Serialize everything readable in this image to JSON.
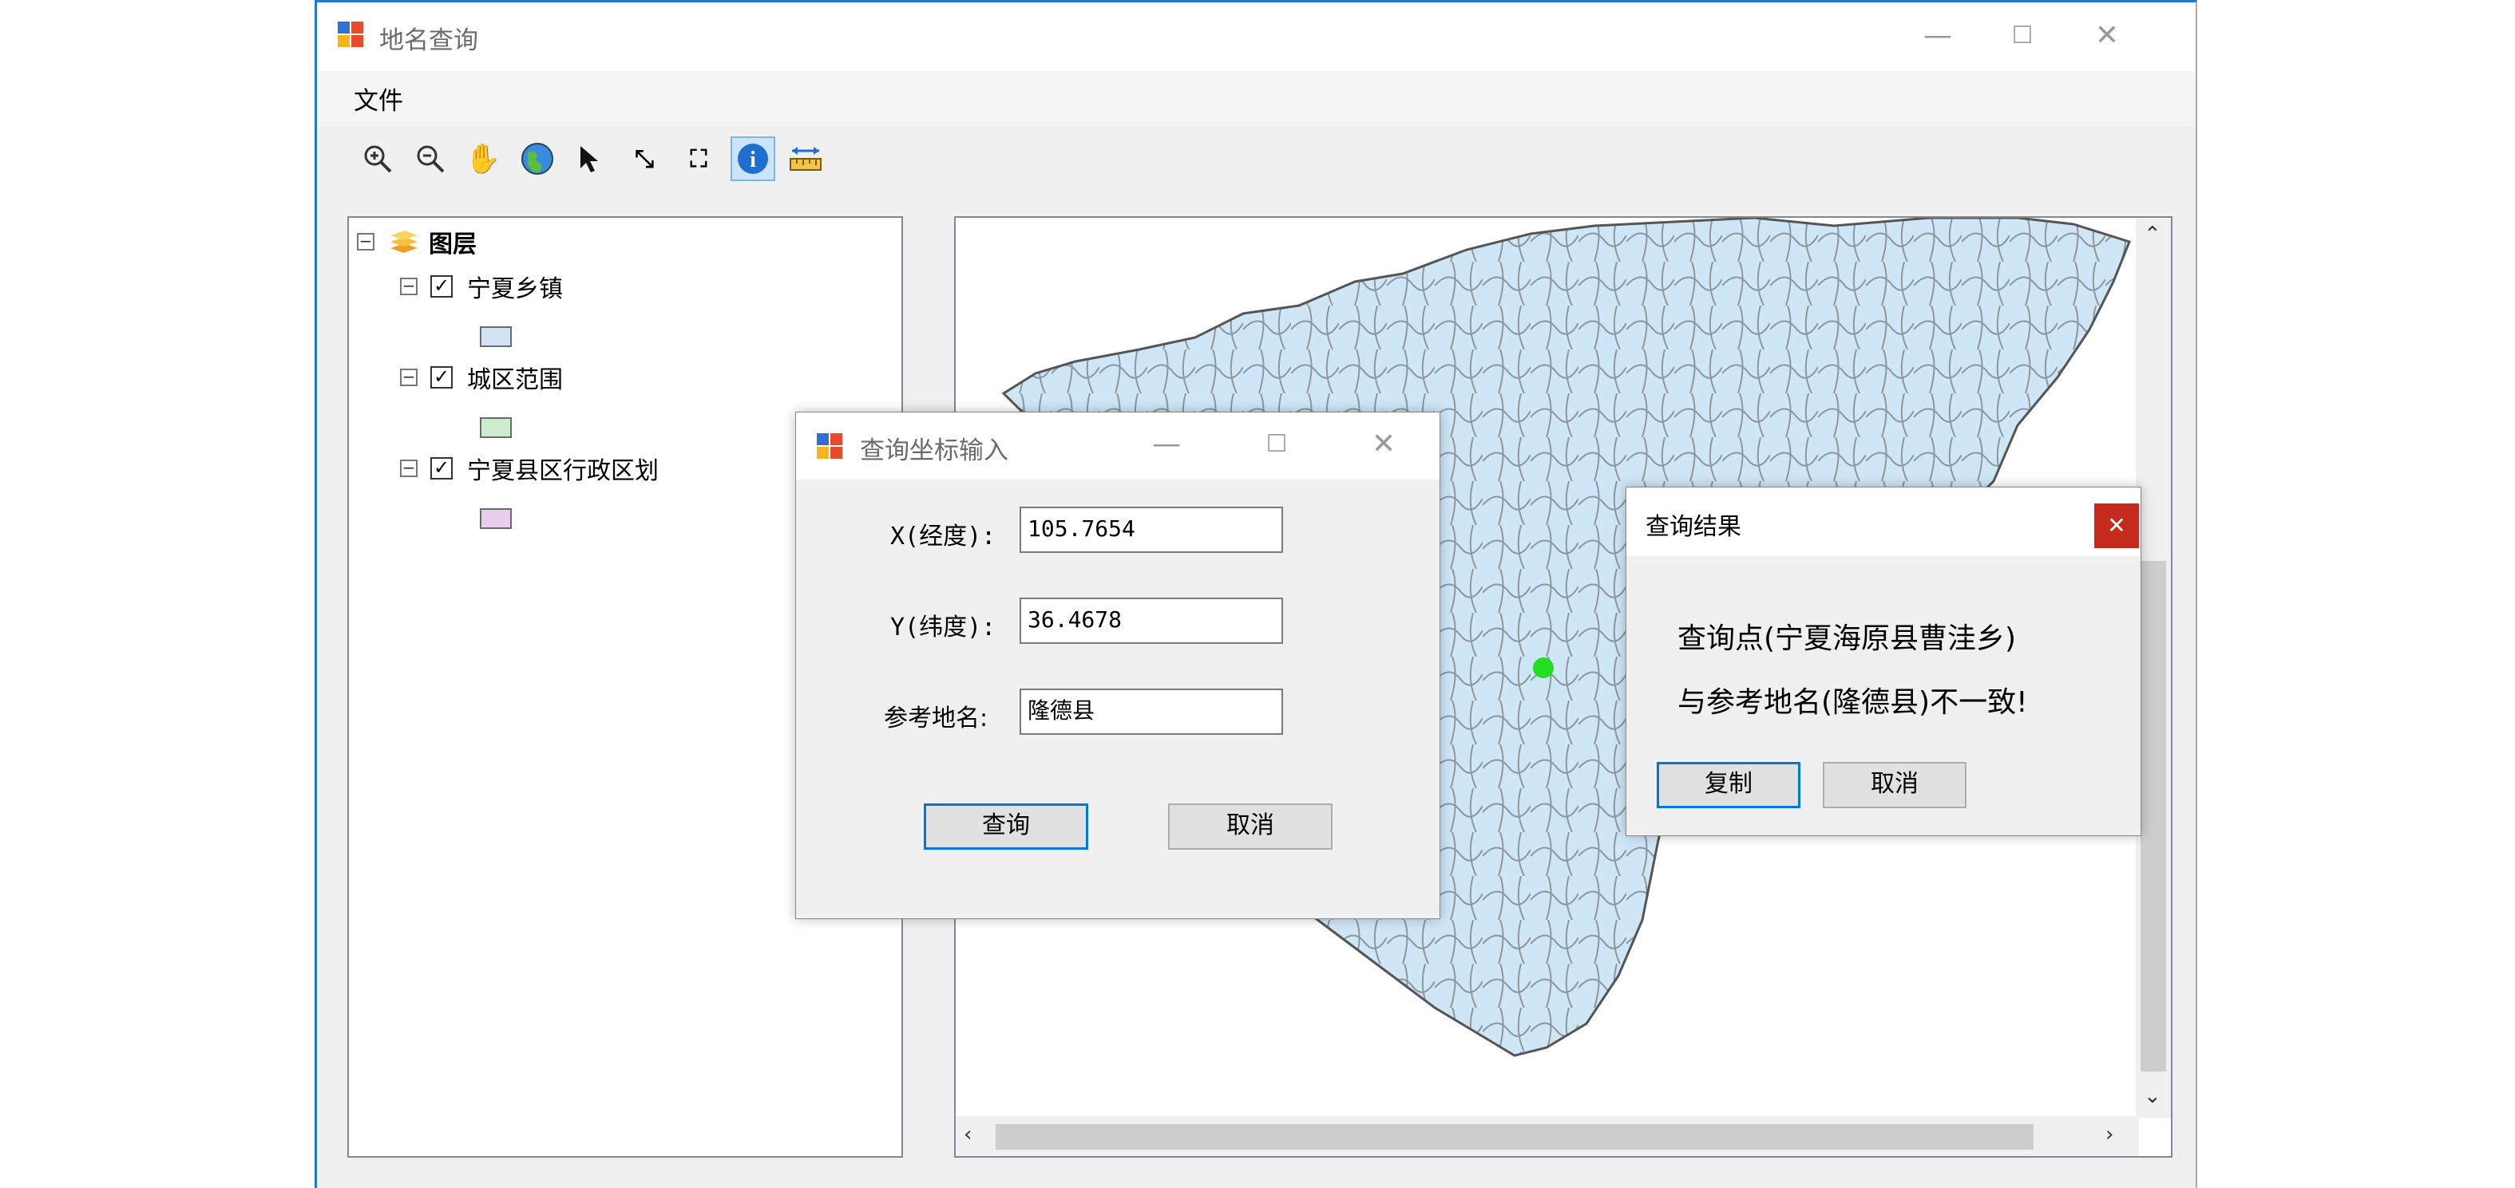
{
  "main_window": {
    "title": "地名查询",
    "menu": {
      "file": "文件"
    },
    "toolbar_icons": [
      "zoom-in-icon",
      "zoom-out-icon",
      "pan-hand-icon",
      "globe-full-extent-icon",
      "select-arrow-icon",
      "fixed-zoom-in-icon",
      "fixed-zoom-out-icon",
      "identify-info-icon",
      "measure-ruler-icon"
    ],
    "active_tool": "identify-info-icon"
  },
  "toc": {
    "root": "图层",
    "layers": [
      {
        "name": "宁夏乡镇",
        "checked": true,
        "swatch_color": "#cfe3f5"
      },
      {
        "name": "城区范围",
        "checked": true,
        "swatch_color": "#cdeccd"
      },
      {
        "name": "宁夏县区行政区划",
        "checked": true,
        "swatch_color": "#eccdf0"
      }
    ]
  },
  "map": {
    "fill_color": "#cfe6f7",
    "outline_color": "#555555",
    "query_point_color": "#22dd22"
  },
  "coord_dialog": {
    "title": "查询坐标输入",
    "x_label": "X(经度):",
    "x_value": "105.7654",
    "y_label": "Y(纬度):",
    "y_value": "36.4678",
    "ref_label": "参考地名:",
    "ref_value": "隆德县",
    "query_button": "查询",
    "cancel_button": "取消"
  },
  "result_dialog": {
    "title": "查询结果",
    "line1": "查询点(宁夏海原县曹洼乡)",
    "line2": "与参考地名(隆德县)不一致!",
    "copy_button": "复制",
    "cancel_button": "取消"
  }
}
